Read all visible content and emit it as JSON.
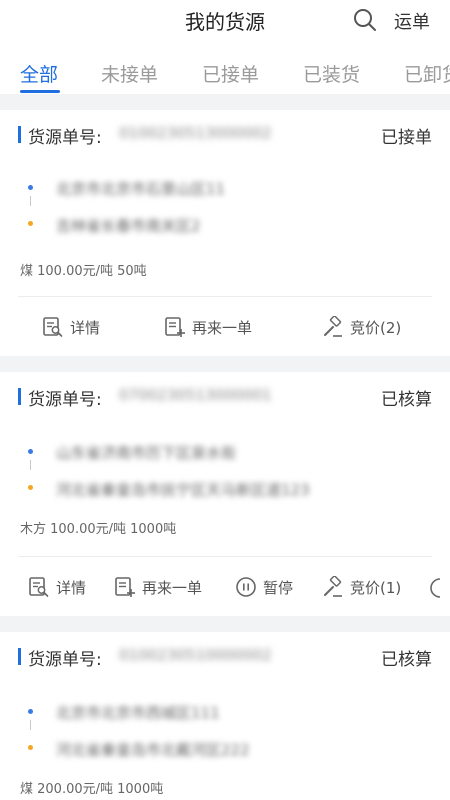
{
  "header": {
    "title": "我的货源",
    "right_action": "运单"
  },
  "tabs": [
    {
      "label": "全部",
      "active": true
    },
    {
      "label": "未接单"
    },
    {
      "label": "已接单"
    },
    {
      "label": "已装货"
    },
    {
      "label": "已卸货"
    }
  ],
  "cards": [
    {
      "label": "货源单号:",
      "order_no": "0100230513000002",
      "status": "已接单",
      "from": "北京市北京市石景山区11",
      "to": "吉林省长春市南关区2",
      "goods": "煤  100.00元/吨  50吨",
      "actions": {
        "detail": "详情",
        "reorder": "再来一单",
        "bid": "竞价(2)"
      }
    },
    {
      "label": "货源单号:",
      "order_no": "0700230513000001",
      "status": "已核算",
      "from": "山东省济南市历下区泉水街",
      "to": "河北省秦皇岛市抚宁区天马新区道123",
      "goods": "木方  100.00元/吨  1000吨",
      "actions": {
        "detail": "详情",
        "reorder": "再来一单",
        "pause": "暂停",
        "bid": "竞价(1)"
      }
    },
    {
      "label": "货源单号:",
      "order_no": "0100230510000002",
      "status": "已核算",
      "from": "北京市北京市西城区111",
      "to": "河北省秦皇岛市北戴河区222",
      "goods": "煤  200.00元/吨  1000吨"
    }
  ],
  "colors": {
    "accent": "#1f6fde",
    "from_dot": "#3a7be8",
    "to_dot": "#f5a623",
    "background": "#f2f3f5"
  },
  "icons": {
    "search": "search-icon",
    "detail": "document-search-icon",
    "reorder": "document-plus-icon",
    "pause": "pause-circle-icon",
    "bid": "gavel-icon"
  }
}
